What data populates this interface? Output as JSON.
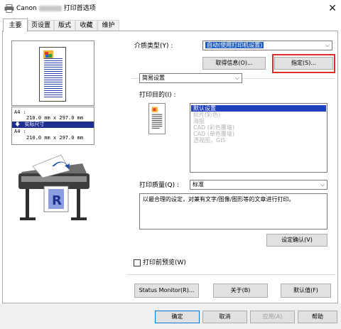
{
  "window": {
    "app_name": "Canon",
    "title": "打印首选项",
    "close_label": "✕"
  },
  "tabs": [
    "主要",
    "页设置",
    "版式",
    "收藏",
    "维护"
  ],
  "preview": {
    "size_top_label": "A4 :",
    "size_top_dims": "210.0 mm x 297.0 mm",
    "size_mode": "实际尺寸",
    "size_bottom_label": "A4 :",
    "size_bottom_dims": "210.0 mm x 297.0 mm"
  },
  "media": {
    "label": "介质类型(Y) :",
    "value": "自动(使用打印机设置)",
    "get_info_button": "取得信息(O)...",
    "specify_button": "指定(S)..."
  },
  "mode": {
    "value": "简易设置"
  },
  "purpose": {
    "label": "打印目的(I) :",
    "items": [
      "默认设置",
      "照片(彩色)",
      "海报",
      "CAD (彩色覆墙)",
      "CAD (单色覆墙)",
      "透视图，GIS"
    ],
    "selected_index": 0
  },
  "quality": {
    "label": "打印质量(Q) :",
    "value": "标准"
  },
  "description": "以最合理的设定，对兼有文字/图像/图形等的文章进行打印。",
  "confirm_settings_button": "设定确认(V)",
  "preview_checkbox": {
    "label": "打印前预览(W)",
    "checked": false
  },
  "utility_buttons": {
    "status_monitor": "Status Monitor(R)...",
    "about": "关于(B)",
    "defaults": "默认值(F)"
  },
  "dialog_buttons": {
    "ok": "确定",
    "cancel": "取消",
    "apply": "应用(A)",
    "help": "帮助"
  },
  "colors": {
    "accent_selection": "#1f3fbf",
    "highlight_frame": "#e02b2b",
    "dialog_background": "#f0f0f0"
  }
}
